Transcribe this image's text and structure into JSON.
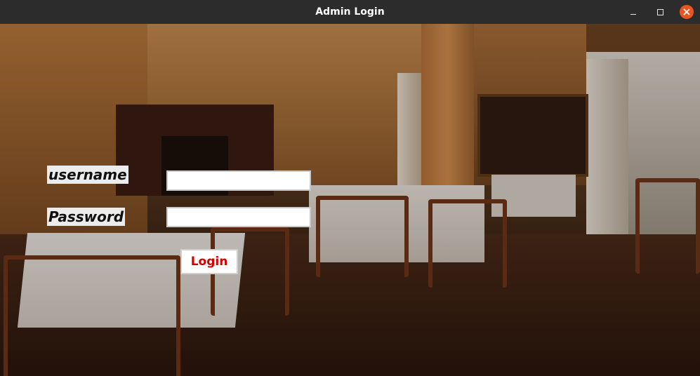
{
  "window": {
    "title": "Admin Login",
    "controls": {
      "minimize_icon": "minimize-icon",
      "maximize_icon": "maximize-icon",
      "close_icon": "close-icon",
      "close_color": "#e95420"
    }
  },
  "form": {
    "username_label": "username",
    "password_label": "Password",
    "username_value": "",
    "password_value": "",
    "login_label": "Login",
    "login_color": "#d40000"
  },
  "background": {
    "description_icon": "restaurant-background-image"
  }
}
